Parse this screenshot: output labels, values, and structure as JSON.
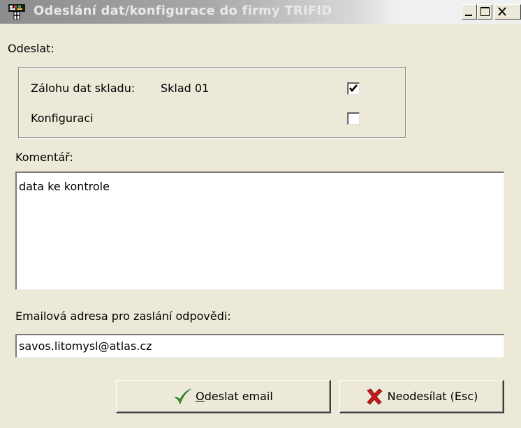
{
  "window": {
    "title": "Odeslání dat/konfigurace do firmy TRIFID"
  },
  "send_section": {
    "label": "Odeslat:",
    "backup_label": "Zálohu dat skladu:",
    "backup_value": "Sklad 01",
    "backup_checked": true,
    "config_label": "Konfiguraci",
    "config_checked": false
  },
  "comment": {
    "label": "Komentář:",
    "value": "data ke kontrole"
  },
  "email": {
    "label": "Emailová adresa pro zaslání odpovědi:",
    "value": "savos.litomysl@atlas.cz"
  },
  "buttons": {
    "send_mnemonic": "O",
    "send_rest": "deslat email",
    "cancel_label": "Neodesílat (Esc)"
  },
  "icons": {
    "app": "app-icon",
    "send": "check-icon",
    "cancel": "cross-icon"
  },
  "colors": {
    "check_green": "#2e9a2e",
    "cross_red": "#c81818"
  }
}
